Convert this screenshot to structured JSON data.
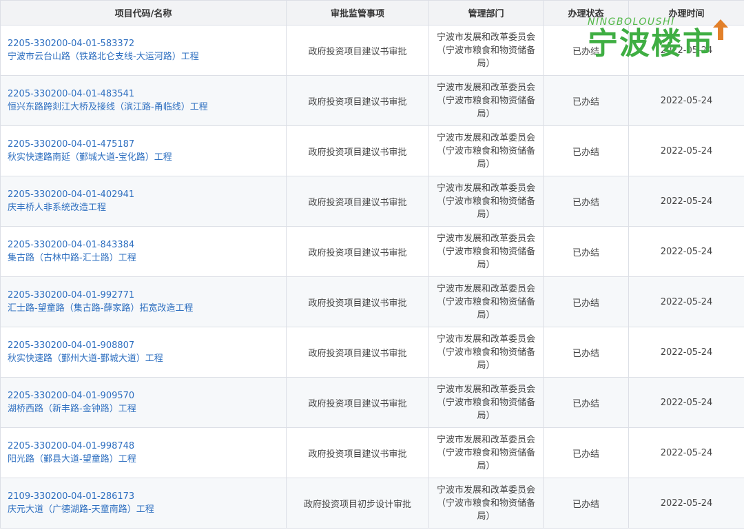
{
  "headers": {
    "project": "项目代码/名称",
    "item": "审批监管事项",
    "dept": "管理部门",
    "status": "办理状态",
    "time": "办理时间"
  },
  "rows": [
    {
      "code": "2205-330200-04-01-583372",
      "name": "宁波市云台山路（铁路北仑支线-大运河路）工程",
      "item": "政府投资项目建议书审批",
      "dept": "宁波市发展和改革委员会（宁波市粮食和物资储备局）",
      "status": "已办结",
      "time": "2022-05-24"
    },
    {
      "code": "2205-330200-04-01-483541",
      "name": "恒兴东路跨剡江大桥及接线（滨江路-甬临线）工程",
      "item": "政府投资项目建议书审批",
      "dept": "宁波市发展和改革委员会（宁波市粮食和物资储备局）",
      "status": "已办结",
      "time": "2022-05-24"
    },
    {
      "code": "2205-330200-04-01-475187",
      "name": "秋实快速路南延（鄞城大道-宝化路）工程",
      "item": "政府投资项目建议书审批",
      "dept": "宁波市发展和改革委员会（宁波市粮食和物资储备局）",
      "status": "已办结",
      "time": "2022-05-24"
    },
    {
      "code": "2205-330200-04-01-402941",
      "name": "庆丰桥人非系统改造工程",
      "item": "政府投资项目建议书审批",
      "dept": "宁波市发展和改革委员会（宁波市粮食和物资储备局）",
      "status": "已办结",
      "time": "2022-05-24"
    },
    {
      "code": "2205-330200-04-01-843384",
      "name": "集古路（古林中路-汇士路）工程",
      "item": "政府投资项目建议书审批",
      "dept": "宁波市发展和改革委员会（宁波市粮食和物资储备局）",
      "status": "已办结",
      "time": "2022-05-24"
    },
    {
      "code": "2205-330200-04-01-992771",
      "name": "汇士路-望童路（集古路-薛家路）拓宽改造工程",
      "item": "政府投资项目建议书审批",
      "dept": "宁波市发展和改革委员会（宁波市粮食和物资储备局）",
      "status": "已办结",
      "time": "2022-05-24"
    },
    {
      "code": "2205-330200-04-01-908807",
      "name": "秋实快速路（鄞州大道-鄞城大道）工程",
      "item": "政府投资项目建议书审批",
      "dept": "宁波市发展和改革委员会（宁波市粮食和物资储备局）",
      "status": "已办结",
      "time": "2022-05-24"
    },
    {
      "code": "2205-330200-04-01-909570",
      "name": "湖桥西路（新丰路-金钟路）工程",
      "item": "政府投资项目建议书审批",
      "dept": "宁波市发展和改革委员会（宁波市粮食和物资储备局）",
      "status": "已办结",
      "time": "2022-05-24"
    },
    {
      "code": "2205-330200-04-01-998748",
      "name": "阳光路（鄞县大道-望童路）工程",
      "item": "政府投资项目建议书审批",
      "dept": "宁波市发展和改革委员会（宁波市粮食和物资储备局）",
      "status": "已办结",
      "time": "2022-05-24"
    },
    {
      "code": "2109-330200-04-01-286173",
      "name": "庆元大道（广德湖路-天童南路）工程",
      "item": "政府投资项目初步设计审批",
      "dept": "宁波市发展和改革委员会（宁波市粮食和物资储备局）",
      "status": "已办结",
      "time": "2022-05-24"
    }
  ],
  "watermark": {
    "en": "NINGBOLOUSHI",
    "cn": "宁波楼市",
    "color": "#3fae43"
  }
}
